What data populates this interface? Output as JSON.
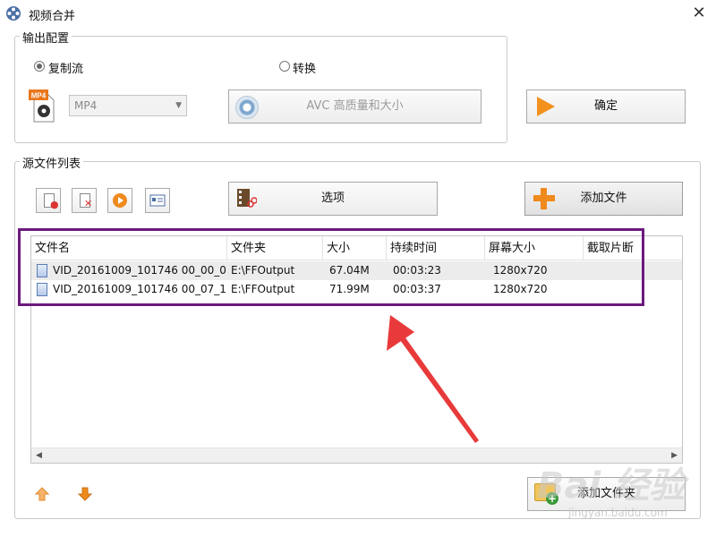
{
  "window": {
    "title": "视频合并",
    "close_glyph": "✕"
  },
  "output_config": {
    "legend": "输出配置",
    "radio_copy": {
      "label": "复制流",
      "checked": true
    },
    "radio_convert": {
      "label": "转换",
      "checked": false
    },
    "format_badge": "MP4",
    "format_select": {
      "value": "MP4"
    },
    "quality_button": "AVC 高质量和大小",
    "confirm_button": "确定"
  },
  "source_list": {
    "legend": "源文件列表",
    "options_button": "选项",
    "add_file_button": "添加文件",
    "columns": [
      "文件名",
      "文件夹",
      "大小",
      "持续时间",
      "屏幕大小",
      "截取片断"
    ],
    "rows": [
      {
        "name": "VID_20161009_101746 00_00_0...",
        "folder": "E:\\FFOutput",
        "size": "67.04M",
        "duration": "00:03:23",
        "screen": "1280x720",
        "clip": ""
      },
      {
        "name": "VID_20161009_101746 00_07_1...",
        "folder": "E:\\FFOutput",
        "size": "71.99M",
        "duration": "00:03:37",
        "screen": "1280x720",
        "clip": ""
      }
    ],
    "add_folder_button": "添加文件夹"
  },
  "icons": {
    "app": "film-reel-icon",
    "remove": "remove-file-icon",
    "delete": "delete-file-icon",
    "play": "play-icon",
    "info": "media-info-icon",
    "up": "move-up-icon",
    "down": "move-down-icon"
  },
  "annotation": {
    "highlight_color": "#6b1a7e",
    "arrow_color": "#e83a3a"
  },
  "watermark": {
    "text": "Bai 经验",
    "sub": "jingyan.baidu.com"
  }
}
